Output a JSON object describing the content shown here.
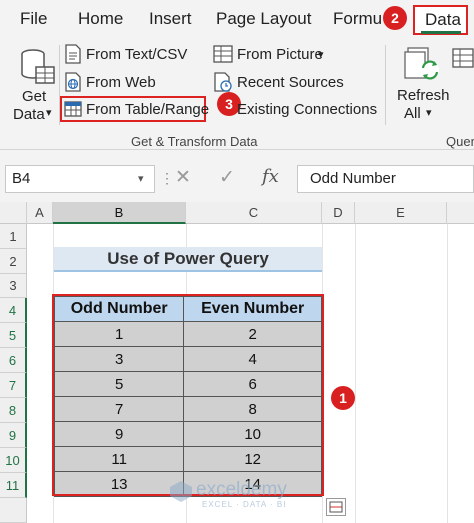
{
  "menu": {
    "file": "File",
    "home": "Home",
    "insert": "Insert",
    "page_layout": "Page Layout",
    "formulas": "Formu",
    "data": "Data"
  },
  "ribbon": {
    "get_data_line1": "Get",
    "get_data_line2": "Data",
    "from_text_csv": "From Text/CSV",
    "from_web": "From Web",
    "from_table_range": "From Table/Range",
    "from_picture": "From Picture",
    "recent_sources": "Recent Sources",
    "existing_connections": "Existing Connections",
    "refresh_line1": "Refresh",
    "refresh_line2": "All",
    "group_label": "Get & Transform Data",
    "next_group_label": "Quer"
  },
  "badges": {
    "b1": "1",
    "b2": "2",
    "b3": "3"
  },
  "formula_bar": {
    "name_box": "B4",
    "formula": "Odd Number"
  },
  "columns": [
    "A",
    "B",
    "C",
    "D",
    "E"
  ],
  "rows": [
    "1",
    "2",
    "3",
    "4",
    "5",
    "6",
    "7",
    "8",
    "9",
    "10",
    "11"
  ],
  "sheet_title": "Use of Power Query",
  "table": {
    "headers": [
      "Odd Number",
      "Even Number"
    ],
    "rows": [
      [
        "1",
        "2"
      ],
      [
        "3",
        "4"
      ],
      [
        "5",
        "6"
      ],
      [
        "7",
        "8"
      ],
      [
        "9",
        "10"
      ],
      [
        "11",
        "12"
      ],
      [
        "13",
        "14"
      ]
    ]
  },
  "watermark": {
    "name": "exceldemy",
    "tagline": "EXCEL · DATA · BI"
  },
  "colors": {
    "accent_green": "#217346",
    "highlight_red": "#d22222",
    "header_blue": "#bfd7ee",
    "cell_grey": "#d0d0d0"
  }
}
